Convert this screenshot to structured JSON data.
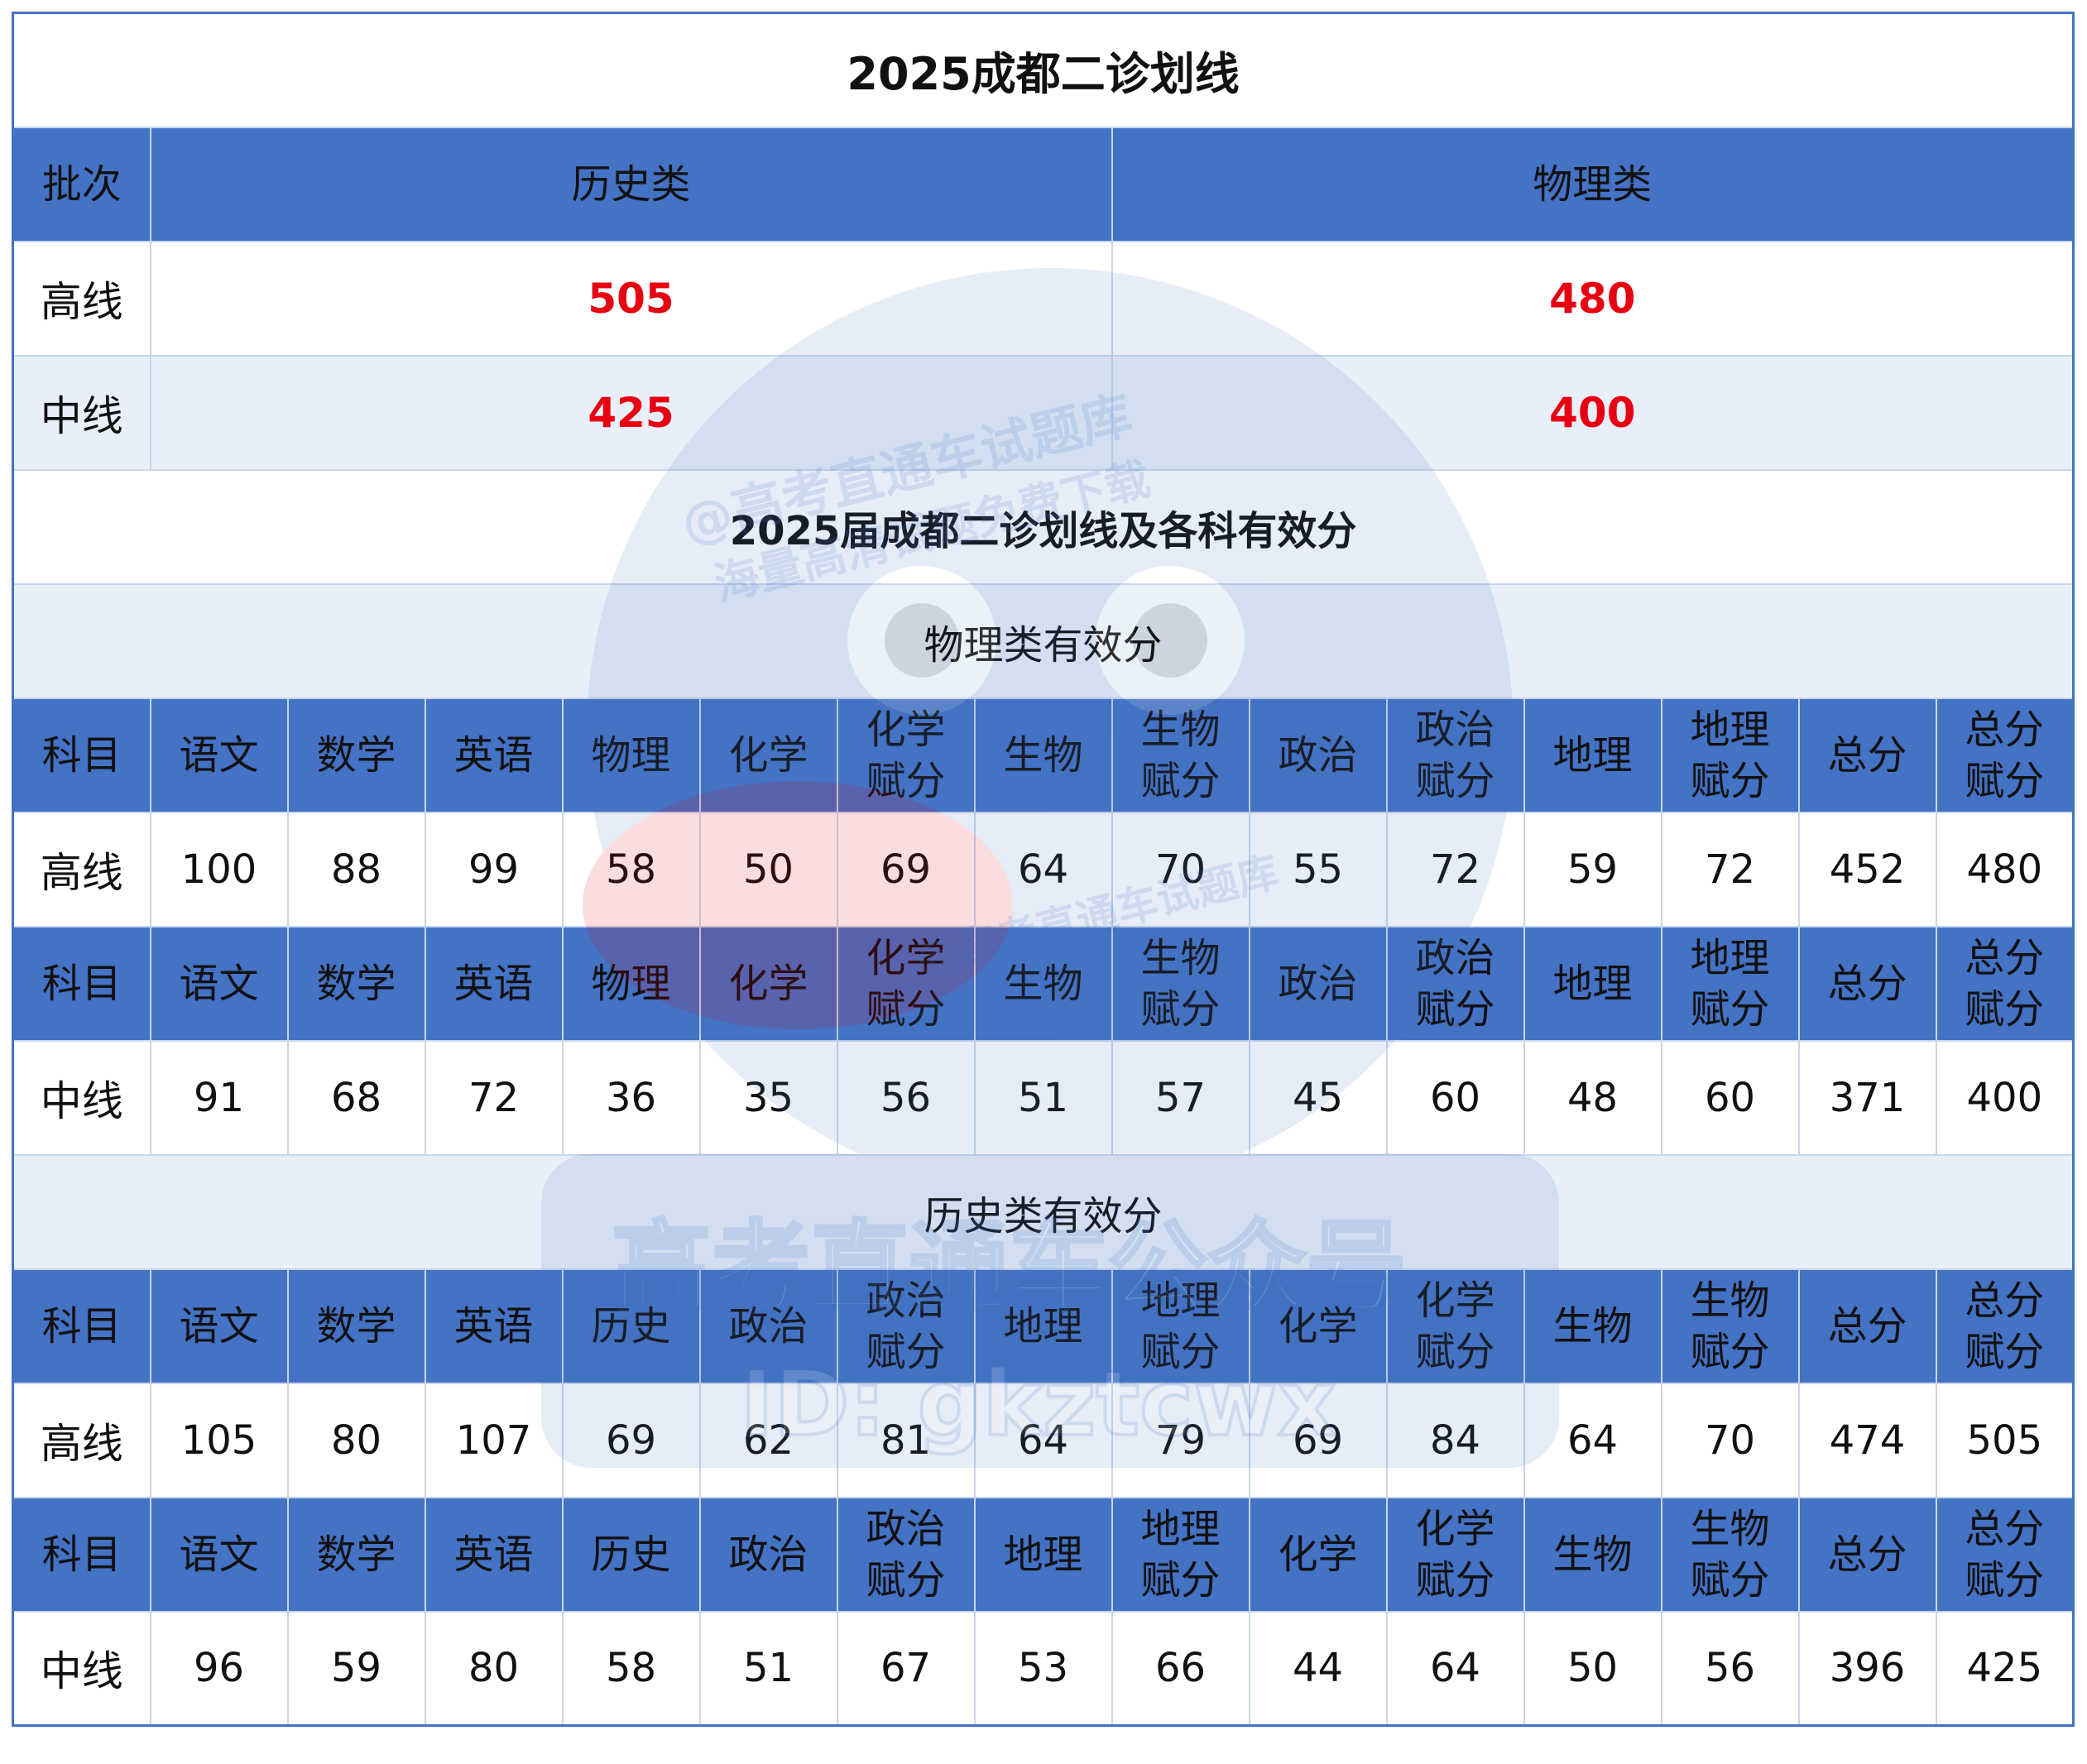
{
  "title": "2025成都二诊划线",
  "summary": {
    "header": {
      "batch": "批次",
      "history": "历史类",
      "physics": "物理类"
    },
    "rows": [
      {
        "label": "高线",
        "history": "505",
        "physics": "480"
      },
      {
        "label": "中线",
        "history": "425",
        "physics": "400"
      }
    ]
  },
  "subtitle": "2025届成都二诊划线及各科有效分",
  "physics": {
    "section_title": "物理类有效分",
    "headers": [
      "科目",
      "语文",
      "数学",
      "英语",
      "物理",
      "化学",
      "化学\n赋分",
      "生物",
      "生物\n赋分",
      "政治",
      "政治\n赋分",
      "地理",
      "地理\n赋分",
      "总分",
      "总分\n赋分"
    ],
    "high": [
      "高线",
      "100",
      "88",
      "99",
      "58",
      "50",
      "69",
      "64",
      "70",
      "55",
      "72",
      "59",
      "72",
      "452",
      "480"
    ],
    "mid": [
      "中线",
      "91",
      "68",
      "72",
      "36",
      "35",
      "56",
      "51",
      "57",
      "45",
      "60",
      "48",
      "60",
      "371",
      "400"
    ]
  },
  "history": {
    "section_title": "历史类有效分",
    "headers": [
      "科目",
      "语文",
      "数学",
      "英语",
      "历史",
      "政治",
      "政治\n赋分",
      "地理",
      "地理\n赋分",
      "化学",
      "化学\n赋分",
      "生物",
      "生物\n赋分",
      "总分",
      "总分\n赋分"
    ],
    "high": [
      "高线",
      "105",
      "80",
      "107",
      "69",
      "62",
      "81",
      "64",
      "79",
      "69",
      "84",
      "64",
      "70",
      "474",
      "505"
    ],
    "mid": [
      "中线",
      "96",
      "59",
      "80",
      "58",
      "51",
      "67",
      "53",
      "66",
      "44",
      "64",
      "50",
      "56",
      "396",
      "425"
    ]
  },
  "watermark": {
    "line1": "@高考直通车试题库",
    "line2": "海量高清试题免费下载",
    "big": "高考直通车公众号",
    "id": "ID: gkztcwx"
  },
  "colors": {
    "accent": "#4472c4",
    "header_bg": "#4472c4",
    "highlight": "#e60012",
    "stripe": "#e9eff8"
  }
}
